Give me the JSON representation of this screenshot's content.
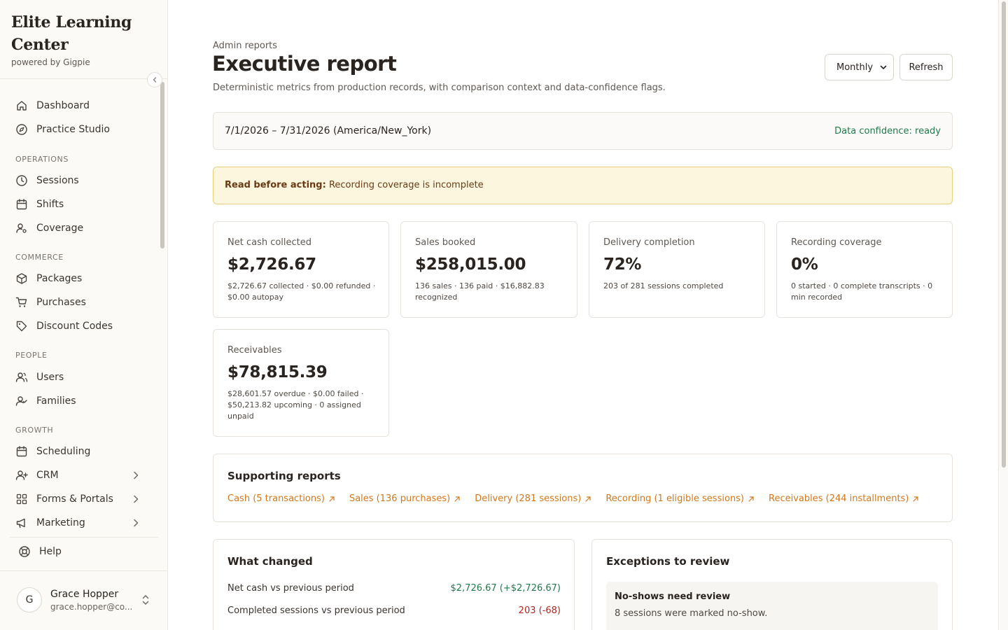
{
  "brand": {
    "name": "Elite Learning Center",
    "powered_by": "powered by Gigpie"
  },
  "nav": {
    "top_items": [
      {
        "label": "Dashboard",
        "icon": "home-icon"
      },
      {
        "label": "Practice Studio",
        "icon": "compass-icon"
      }
    ],
    "sections": [
      {
        "title": "OPERATIONS",
        "items": [
          {
            "label": "Sessions",
            "icon": "clock-icon"
          },
          {
            "label": "Shifts",
            "icon": "calendar-icon"
          },
          {
            "label": "Coverage",
            "icon": "user-cog-icon"
          }
        ]
      },
      {
        "title": "COMMERCE",
        "items": [
          {
            "label": "Packages",
            "icon": "package-icon"
          },
          {
            "label": "Purchases",
            "icon": "cart-icon"
          },
          {
            "label": "Discount Codes",
            "icon": "tag-icon"
          }
        ]
      },
      {
        "title": "PEOPLE",
        "items": [
          {
            "label": "Users",
            "icon": "users-icon"
          },
          {
            "label": "Families",
            "icon": "user-check-icon"
          }
        ]
      },
      {
        "title": "GROWTH",
        "items": [
          {
            "label": "Scheduling",
            "icon": "calendar-icon"
          },
          {
            "label": "CRM",
            "icon": "user-plus-icon"
          },
          {
            "label": "Forms & Portals",
            "icon": "grid-icon"
          },
          {
            "label": "Marketing",
            "icon": "megaphone-icon"
          }
        ]
      }
    ],
    "help_label": "Help"
  },
  "user": {
    "initial": "G",
    "name": "Grace Hopper",
    "email": "grace.hopper@co..."
  },
  "header": {
    "eyebrow": "Admin reports",
    "title": "Executive report",
    "subtitle": "Deterministic metrics from production records, with comparison context and data-confidence flags.",
    "period": "Monthly",
    "refresh_label": "Refresh"
  },
  "range": {
    "text": "7/1/2026 – 7/31/2026 (America/New_York)",
    "confidence": "Data confidence: ready"
  },
  "alert": {
    "lead": "Read before acting:",
    "message": "Recording coverage is incomplete"
  },
  "metrics": [
    {
      "label": "Net cash collected",
      "value": "$2,726.67",
      "detail": "$2,726.67 collected · $0.00 refunded · $0.00 autopay"
    },
    {
      "label": "Sales booked",
      "value": "$258,015.00",
      "detail": "136 sales · 136 paid · $16,882.83 recognized"
    },
    {
      "label": "Delivery completion",
      "value": "72%",
      "detail": "203 of 281 sessions completed"
    },
    {
      "label": "Recording coverage",
      "value": "0%",
      "detail": "0 started · 0 complete transcripts · 0 min recorded"
    },
    {
      "label": "Receivables",
      "value": "$78,815.39",
      "detail": "$28,601.57 overdue · $0.00 failed · $50,213.82 upcoming · 0 assigned unpaid"
    }
  ],
  "supporting": {
    "title": "Supporting reports",
    "links": [
      "Cash (5 transactions)",
      "Sales (136 purchases)",
      "Delivery (281 sessions)",
      "Recording (1 eligible sessions)",
      "Receivables (244 installments)"
    ]
  },
  "changes": {
    "title": "What changed",
    "rows": [
      {
        "label": "Net cash vs previous period",
        "value": "$2,726.67 (+$2,726.67)",
        "trend": "positive"
      },
      {
        "label": "Completed sessions vs previous period",
        "value": "203 (-68)",
        "trend": "negative"
      }
    ]
  },
  "exceptions": {
    "title": "Exceptions to review",
    "items": [
      {
        "title": "No-shows need review",
        "description": "8 sessions were marked no-show."
      }
    ]
  },
  "colors": {
    "accent": "#d2781c",
    "positive": "#1f7a4a",
    "negative": "#b3261e",
    "alert_bg": "#fcf6df",
    "alert_border": "#e9cf7c"
  }
}
